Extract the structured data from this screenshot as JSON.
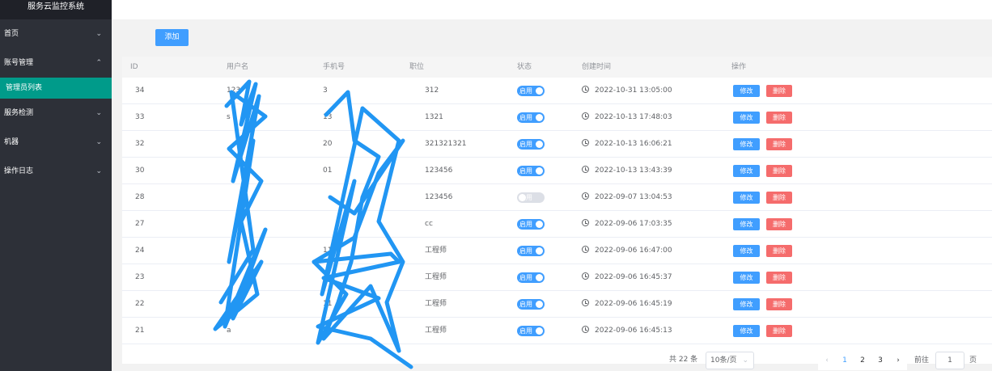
{
  "app": {
    "title": "服务云监控系统"
  },
  "sidebar": {
    "items": [
      {
        "label": "首页",
        "chevron": "chevron-down"
      },
      {
        "label": "账号管理",
        "chevron": "chevron-up"
      },
      {
        "label": "服务检测",
        "chevron": "chevron-down"
      },
      {
        "label": "机器",
        "chevron": "chevron-down"
      },
      {
        "label": "操作日志",
        "chevron": "chevron-down"
      }
    ],
    "subitem": {
      "label": "管理员列表"
    }
  },
  "toolbar": {
    "add_label": "添加"
  },
  "table": {
    "headers": {
      "id": "ID",
      "user": "用户名",
      "phone": "手机号",
      "position": "职位",
      "state": "状态",
      "created": "创建时间",
      "ops": "操作"
    },
    "switch_label": "启用",
    "edit_label": "修改",
    "delete_label": "删除",
    "rows": [
      {
        "id": "34",
        "user": "123",
        "phone": "3",
        "position": "312",
        "enabled": true,
        "time": "2022-10-31 13:05:00"
      },
      {
        "id": "33",
        "user": "s",
        "phone": "13",
        "position": "1321",
        "enabled": true,
        "time": "2022-10-13 17:48:03"
      },
      {
        "id": "32",
        "user": "",
        "phone": "20",
        "position": "321321321",
        "enabled": true,
        "time": "2022-10-13 16:06:21"
      },
      {
        "id": "30",
        "user": "",
        "phone": "01",
        "position": "123456",
        "enabled": true,
        "time": "2022-10-13 13:43:39"
      },
      {
        "id": "28",
        "user": "",
        "phone": "",
        "position": "123456",
        "enabled": false,
        "time": "2022-09-07 13:04:53"
      },
      {
        "id": "27",
        "user": "",
        "phone": "",
        "position": "cc",
        "enabled": true,
        "time": "2022-09-06 17:03:35"
      },
      {
        "id": "24",
        "user": "",
        "phone": "11",
        "position": "工程师",
        "enabled": true,
        "time": "2022-09-06 16:47:00"
      },
      {
        "id": "23",
        "user": "",
        "phone": "",
        "position": "工程师",
        "enabled": true,
        "time": "2022-09-06 16:45:37"
      },
      {
        "id": "22",
        "user": "1",
        "phone": "11",
        "position": "工程师",
        "enabled": true,
        "time": "2022-09-06 16:45:19"
      },
      {
        "id": "21",
        "user": "a",
        "phone": "011",
        "position": "工程师",
        "enabled": true,
        "time": "2022-09-06 16:45:13"
      }
    ]
  },
  "pagination": {
    "total": "共 22 条",
    "page_size": "10条/页",
    "pages": [
      "1",
      "2",
      "3"
    ],
    "current": "1",
    "goto_label": "前往",
    "goto_value": "1",
    "goto_suffix": "页"
  },
  "colors": {
    "primary": "#409eff",
    "danger": "#f56c6c",
    "sidebar": "#2d3038",
    "active_menu": "#009b8a",
    "scribble": "#2196f3"
  }
}
